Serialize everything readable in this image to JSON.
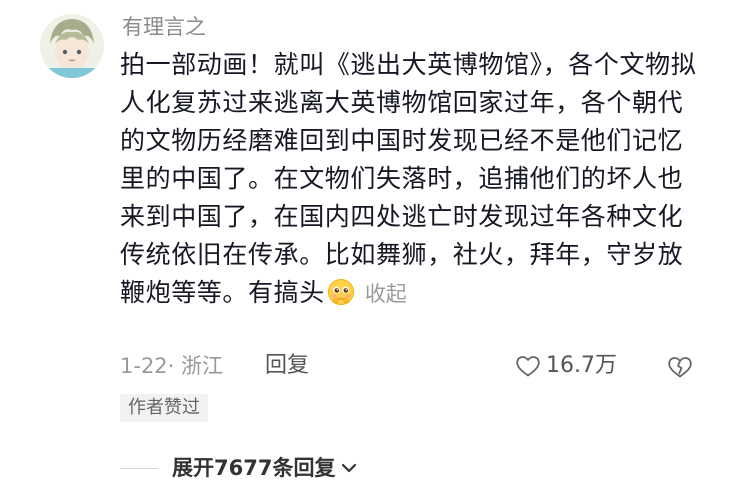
{
  "comment": {
    "username": "有理言之",
    "text": "拍一部动画！就叫《逃出大英博物馆》，各个文物拟人化复苏过来逃离大英博物馆回家过年，各个朝代的文物历经磨难回到中国时发现已经不是他们记忆里的中国了。在文物们失落时，追捕他们的坏人也来到中国了，在国内四处逃亡时发现过年各种文化传统依旧在传承。比如舞狮，社火，拜年，守岁放鞭炮等等。有搞头",
    "emoji_icon": "pleading-face-emoji-icon",
    "collapse_label": "收起",
    "date_location": "1-22· 浙江",
    "reply_label": "回复",
    "like_count": "16.7万",
    "author_liked_badge": "作者赞过"
  },
  "replies": {
    "expand_label": "展开7677条回复"
  },
  "colors": {
    "text": "#161823",
    "muted": "#9a9a9a",
    "badge_bg": "#f2f2f3"
  }
}
